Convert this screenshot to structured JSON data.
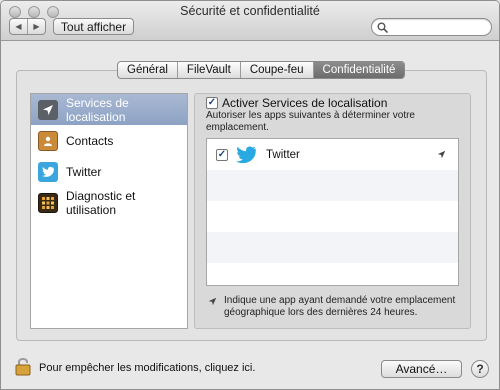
{
  "window": {
    "title": "Sécurité et confidentialité"
  },
  "toolbar": {
    "back_icon": "chevron-left",
    "forward_icon": "chevron-right",
    "show_all_label": "Tout afficher",
    "search_placeholder": "",
    "search_value": ""
  },
  "tabs": [
    {
      "label": "Général",
      "active": false
    },
    {
      "label": "FileVault",
      "active": false
    },
    {
      "label": "Coupe-feu",
      "active": false
    },
    {
      "label": "Confidentialité",
      "active": true
    }
  ],
  "sidebar": {
    "items": [
      {
        "label": "Services de localisation",
        "icon": "location-arrow",
        "selected": true
      },
      {
        "label": "Contacts",
        "icon": "contacts-book",
        "selected": false
      },
      {
        "label": "Twitter",
        "icon": "twitter-bird",
        "selected": false
      },
      {
        "label": "Diagnostic et utilisation",
        "icon": "diagnostics-grid",
        "selected": false
      }
    ]
  },
  "location": {
    "enable_label": "Activer Services de localisation",
    "enable_checked": true,
    "description": "Autoriser les apps suivantes à déterminer votre emplacement.",
    "apps": [
      {
        "name": "Twitter",
        "checked": true,
        "recent_use": true
      }
    ],
    "legend": "Indique une app ayant demandé votre emplacement géographique lors des dernières 24 heures."
  },
  "footer": {
    "lock_text": "Pour empêcher les modifications, cliquez ici.",
    "advanced_label": "Avancé…",
    "help_label": "?"
  },
  "colors": {
    "selection": "#95a8c8",
    "active_tab": "#7a7a7a",
    "twitter_blue": "#29a9e1"
  }
}
